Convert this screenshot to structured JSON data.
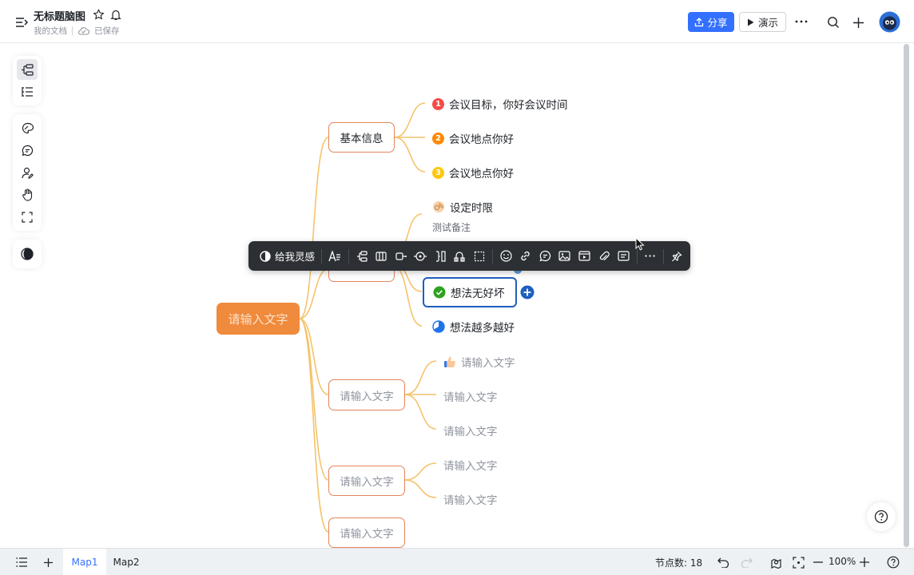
{
  "header": {
    "title": "无标题脑图",
    "location": "我的文档",
    "save_status": "已保存",
    "share_label": "分享",
    "present_label": "演示"
  },
  "toolbar": {
    "inspire_label": "给我灵感"
  },
  "mindmap": {
    "root": "请输入文字",
    "branches": [
      {
        "label": "基本信息",
        "children": [
          {
            "badge": "1",
            "badge_color": "#f54a45",
            "text": "会议目标，你好会议时间"
          },
          {
            "badge": "2",
            "badge_color": "#ff8800",
            "text": "会议地点你好"
          },
          {
            "badge": "3",
            "badge_color": "#ffc60a",
            "text": "会议地点你好"
          }
        ]
      },
      {
        "label": "",
        "children": [
          {
            "icon": "ok-hand-icon",
            "text": "设定时限",
            "note": "测试备注"
          },
          {
            "icon": "check-circle-icon",
            "text": "想法无好坏",
            "selected": true
          },
          {
            "icon": "progress-pie-icon",
            "text": "想法越多越好"
          }
        ]
      },
      {
        "label": "请输入文字",
        "children": [
          {
            "icon": "thumbs-up-icon",
            "text": "请输入文字"
          },
          {
            "text": "请输入文字"
          },
          {
            "text": "请输入文字"
          }
        ]
      },
      {
        "label": "请输入文字",
        "children": [
          {
            "text": "请输入文字"
          },
          {
            "text": "请输入文字"
          }
        ]
      },
      {
        "label": "请输入文字",
        "children": []
      }
    ]
  },
  "footer": {
    "tabs": [
      "Map1",
      "Map2"
    ],
    "active_tab": "Map1",
    "node_count_label": "节点数: 18",
    "zoom": "100%"
  },
  "colors": {
    "accent": "#3370ff",
    "root_fill": "#f08a3c",
    "branch_border": "#e5855a",
    "connector": "#f5c36b",
    "selected_border": "#1f5fbf"
  }
}
